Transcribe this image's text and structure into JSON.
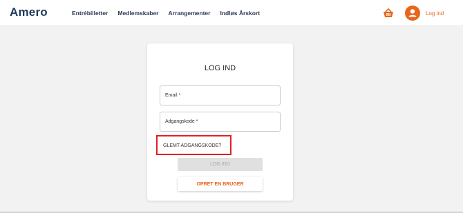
{
  "header": {
    "logo": "Amero",
    "nav": [
      "Entrébilletter",
      "Medlemskaber",
      "Arrangementer",
      "Indløs Årskort"
    ],
    "login_link": "Log ind",
    "cart_icon": "basket-icon",
    "user_icon": "user-icon",
    "accent_color": "#e8651a"
  },
  "card": {
    "title": "LOG IND",
    "email_label": "Email *",
    "password_label": "Adgangskode *",
    "forgot_label": "GLEMT ADGANGSKODE?",
    "login_button": "LOG IND",
    "create_button": "OPRET EN BRUGER"
  }
}
